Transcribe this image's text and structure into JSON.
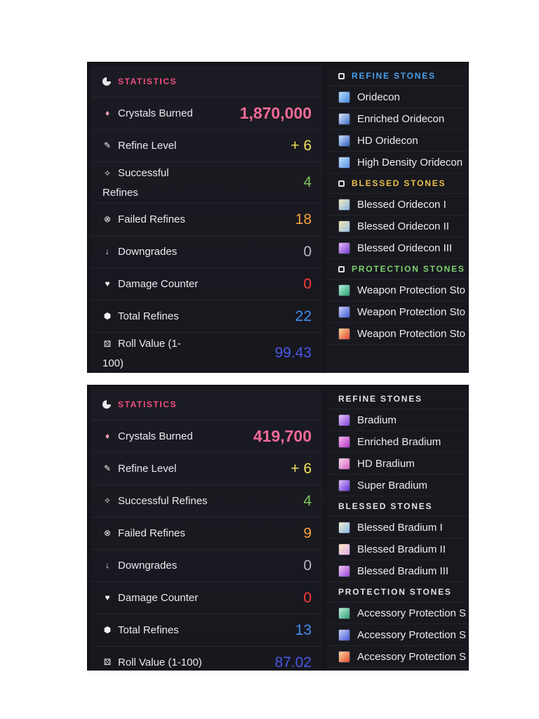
{
  "panel_a": {
    "stats_title": "STATISTICS",
    "rows": [
      {
        "label": "Crystals Burned",
        "value": "1,870,000"
      },
      {
        "label": "Refine Level",
        "value": "+ 6"
      },
      {
        "label": "Successful Refines",
        "value": "4"
      },
      {
        "label": "Failed Refines",
        "value": "18"
      },
      {
        "label": "Downgrades",
        "value": "0"
      },
      {
        "label": "Damage Counter",
        "value": "0"
      },
      {
        "label": "Total Refines",
        "value": "22"
      },
      {
        "label": "Roll Value (1-100)",
        "value": "99.43"
      }
    ],
    "sections": [
      {
        "title": "REFINE STONES",
        "items": [
          "Oridecon",
          "Enriched Oridecon",
          "HD Oridecon",
          "High Density Oridecon"
        ]
      },
      {
        "title": "BLESSED STONES",
        "items": [
          "Blessed Oridecon I",
          "Blessed Oridecon II",
          "Blessed Oridecon III"
        ]
      },
      {
        "title": "PROTECTION STONES",
        "items": [
          "Weapon Protection Sto",
          "Weapon Protection Sto",
          "Weapon Protection Sto"
        ]
      }
    ]
  },
  "panel_b": {
    "stats_title": "STATISTICS",
    "rows": [
      {
        "label": "Crystals Burned",
        "value": "419,700"
      },
      {
        "label": "Refine Level",
        "value": "+ 6"
      },
      {
        "label": "Successful Refines",
        "value": "4"
      },
      {
        "label": "Failed Refines",
        "value": "9"
      },
      {
        "label": "Downgrades",
        "value": "0"
      },
      {
        "label": "Damage Counter",
        "value": "0"
      },
      {
        "label": "Total Refines",
        "value": "13"
      },
      {
        "label": "Roll Value (1-100)",
        "value": "87.02"
      }
    ],
    "sections": [
      {
        "title": "REFINE STONES",
        "items": [
          "Bradium",
          "Enriched Bradium",
          "HD Bradium",
          "Super Bradium"
        ]
      },
      {
        "title": "BLESSED STONES",
        "items": [
          "Blessed Bradium I",
          "Blessed Bradium II",
          "Blessed Bradium III"
        ]
      },
      {
        "title": "PROTECTION STONES",
        "items": [
          "Accessory Protection S",
          "Accessory Protection S",
          "Accessory Protection S"
        ]
      }
    ]
  },
  "colors": {
    "background": "#15151c",
    "statistics_title": "#ef4f7e",
    "crystals": "#f06a98",
    "refine_level": "#f2e05a",
    "successful": "#7cc356",
    "failed": "#f5a23d",
    "downgrades": "#b9b9c2",
    "damage": "#ff3b3b",
    "total": "#3f8ff0",
    "roll": "#4a58e8",
    "refine_stones_header": "#4aa0e8",
    "blessed_stones_header": "#e9c148",
    "protection_stones_header": "#7dcf6e"
  },
  "icons": {
    "statistics": "pie-chart-icon",
    "crystals": "crystal-icon",
    "refine_level": "hammer-icon",
    "successful": "magic-wand-icon",
    "failed": "x-circle-icon",
    "downgrades": "arrow-down-icon",
    "damage": "broken-heart-icon",
    "total": "cube-icon",
    "roll": "dice-icon",
    "section": "cube-outline-icon"
  }
}
